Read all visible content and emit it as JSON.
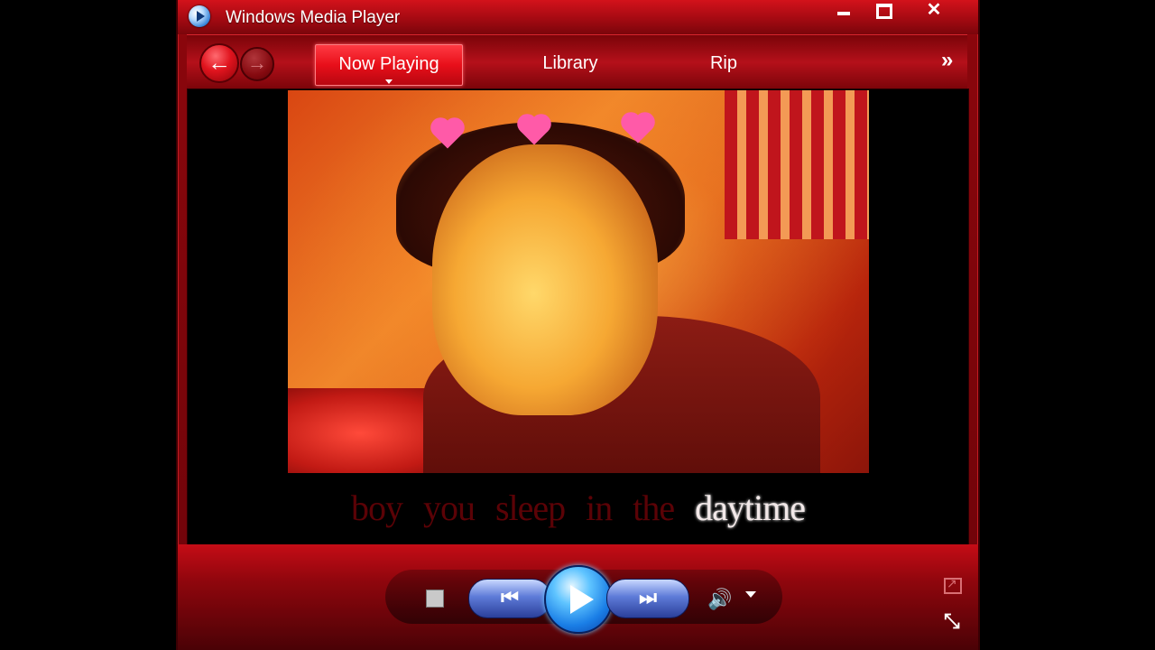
{
  "titlebar": {
    "title": "Windows Media Player",
    "app_icon": "wmp-icon",
    "minimize_icon": "minimize-icon",
    "maximize_icon": "maximize-icon",
    "close_label": "✕"
  },
  "nav": {
    "back_label": "←",
    "forward_label": "→",
    "tabs": [
      {
        "label": "Now Playing",
        "active": true
      },
      {
        "label": "Library",
        "active": false
      },
      {
        "label": "Rip",
        "active": false
      }
    ],
    "more_label": "»"
  },
  "lyrics": {
    "words": [
      "boy",
      "you",
      "sleep",
      "in",
      "the",
      "daytime"
    ],
    "active_index": 5
  },
  "controls": {
    "prev_label": "⏮",
    "next_label": "⏭",
    "volume_label": "🔊",
    "shrink_label": "⤡"
  },
  "colors": {
    "accent": "#e80f1a",
    "play_button": "#1a7ee6"
  }
}
